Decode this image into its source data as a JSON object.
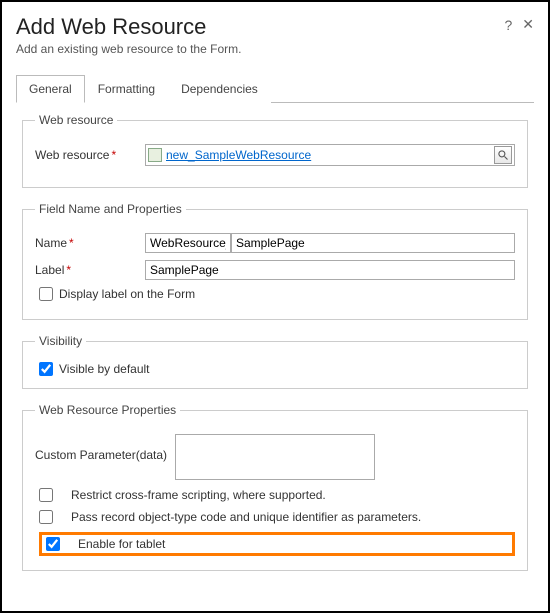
{
  "header": {
    "title": "Add Web Resource",
    "subtitle": "Add an existing web resource to the Form."
  },
  "tabs": {
    "general": "General",
    "formatting": "Formatting",
    "dependencies": "Dependencies"
  },
  "webresource": {
    "legend": "Web resource",
    "label": "Web resource",
    "value": "new_SampleWebResource"
  },
  "fieldprops": {
    "legend": "Field Name and Properties",
    "name_label": "Name",
    "name_prefix": "WebResource_",
    "name_value": "SamplePage",
    "label_label": "Label",
    "label_value": "SamplePage",
    "display_label": "Display label on the Form"
  },
  "visibility": {
    "legend": "Visibility",
    "visible_default": "Visible by default"
  },
  "wrprops": {
    "legend": "Web Resource Properties",
    "custom_param_label": "Custom Parameter(data)",
    "custom_param_value": "",
    "restrict_xframe": "Restrict cross-frame scripting, where supported.",
    "pass_params": "Pass record object-type code and unique identifier as parameters.",
    "enable_tablet": "Enable for tablet"
  }
}
